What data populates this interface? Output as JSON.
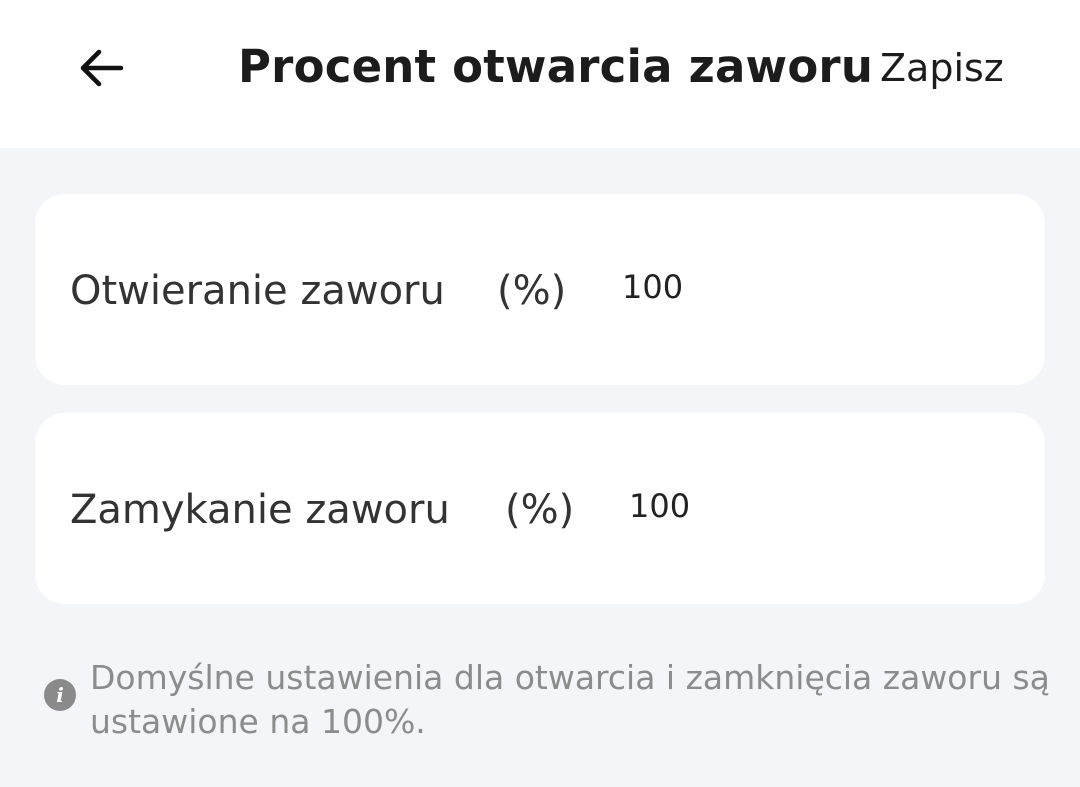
{
  "header": {
    "back_icon": "arrow-left-icon",
    "title": "Procent otwarcia zaworu",
    "save_label": "Zapisz"
  },
  "settings": {
    "opening": {
      "label": "Otwieranie zaworu",
      "unit": "(%)",
      "value": "100"
    },
    "closing": {
      "label": "Zamykanie zaworu",
      "unit": "(%)",
      "value": "100"
    }
  },
  "info": {
    "icon": "info-icon",
    "icon_glyph": "i",
    "text": "Domyślne ustawienia dla otwarcia i zamknięcia zaworu są ustawione na 100%."
  },
  "colors": {
    "background": "#f4f5f9",
    "card": "#ffffff",
    "info_text": "#8c8c8c"
  }
}
